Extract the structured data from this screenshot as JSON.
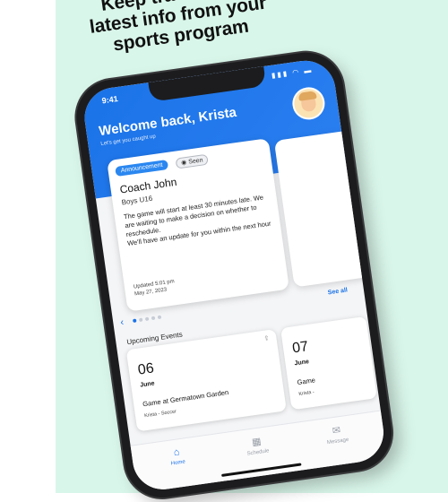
{
  "promo": {
    "line1": "Keep track of the",
    "line2": "latest info from your",
    "line3": "sports program"
  },
  "status": {
    "time": "9:41",
    "icons": "▮▮▮ ◠ ▬"
  },
  "header": {
    "welcome": "Welcome back, Krista",
    "subtitle": "Let's get you caught up"
  },
  "announcement": {
    "badge": "Announcement",
    "seen": "Seen",
    "coach": "Coach John",
    "team": "Boys U16",
    "message_line1": "The game will start at least 30 minutes late. We are waiting to make a decision on whether to reschedule.",
    "message_line2": "We'll have an update for you within the next hour",
    "updated_time": "Updated 5:01 pm",
    "updated_date": "May 27, 2023"
  },
  "carousel": {
    "see_all": "See all",
    "dot_count": 5,
    "active_index": 0
  },
  "events": {
    "title": "Upcoming Events",
    "items": [
      {
        "day": "06",
        "month": "June",
        "title": "Game at Germatown Garden",
        "meta": "Krista - Soccer"
      },
      {
        "day": "07",
        "month": "June",
        "title": "Game",
        "meta": "Krista -"
      }
    ]
  },
  "tabs": [
    {
      "label": "Home",
      "icon": "home-icon",
      "glyph": "⌂"
    },
    {
      "label": "Schedule",
      "icon": "calendar-icon",
      "glyph": "▦"
    },
    {
      "label": "Message",
      "icon": "message-icon",
      "glyph": "✉"
    }
  ],
  "colors": {
    "brand": "#1a73e8",
    "mint": "#d9f6ea"
  }
}
